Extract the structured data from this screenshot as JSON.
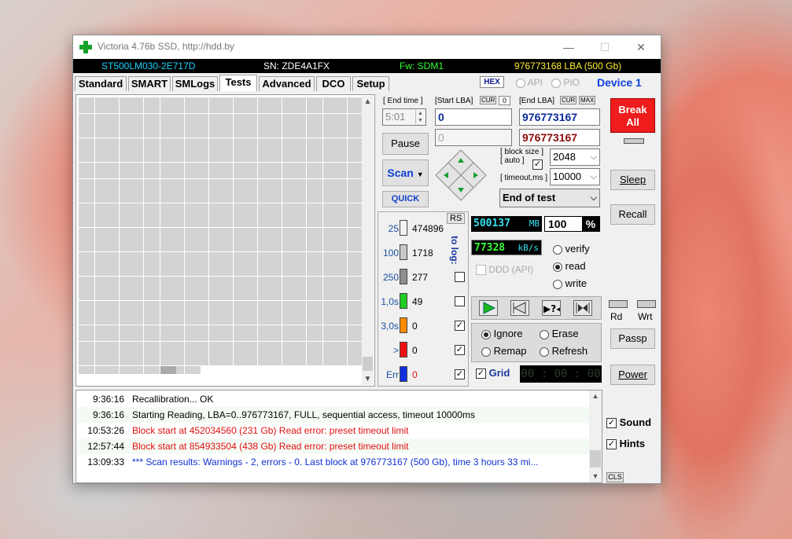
{
  "window": {
    "title": "Victoria 4.76b SSD, http://hdd.by",
    "minimize": "—",
    "maximize": "☐",
    "close": "✕"
  },
  "info": {
    "model": "ST500LM030-2E717D",
    "serial": "SN: ZDE4A1FX",
    "firmware": "Fw: SDM1",
    "capacity": "976773168 LBA (500 Gb)",
    "colors": {
      "model": "#1ad2ff",
      "serial": "#ffffff",
      "firmware": "#33ff33",
      "capacity": "#ffee33"
    }
  },
  "tabs": [
    "Standard",
    "SMART",
    "SMLogs",
    "Tests",
    "Advanced",
    "DCO",
    "Setup"
  ],
  "active_tab": "Tests",
  "mode": {
    "hex": "HEX",
    "api": "API",
    "pio": "PIO",
    "device": "Device 1"
  },
  "test": {
    "end_time_label": "[ End time ]",
    "end_time": "5:01",
    "start_lba_label": "[Start LBA]",
    "start_cur": "CUR",
    "start_zero": "0",
    "start_lba": "0",
    "start_lba2": "0",
    "end_lba_label": "[End LBA]",
    "end_cur": "CUR",
    "end_max": "MAX",
    "end_lba": "976773167",
    "end_lba2": "976773167",
    "pause": "Pause",
    "scan": "Scan",
    "quick": "QUICK",
    "block_size_label": "[ block size ]",
    "auto_label": "[ auto ]",
    "block_size": "2048",
    "timeout_label": "[ timeout,ms ]",
    "timeout": "10000",
    "end_action": "End of test"
  },
  "stats": {
    "rs": "RS",
    "to_log": "to log:",
    "rows": [
      {
        "thr": "25",
        "count": "474896",
        "color": "#f4f4f4",
        "log": null
      },
      {
        "thr": "100",
        "count": "1718",
        "color": "#c8c8c8",
        "log": null
      },
      {
        "thr": "250",
        "count": "277",
        "color": "#8f8f8f",
        "log": false
      },
      {
        "thr": "1,0s",
        "count": "49",
        "color": "#22cc22",
        "log": false
      },
      {
        "thr": "3,0s",
        "count": "0",
        "color": "#ff8a00",
        "log": true
      },
      {
        "thr": ">",
        "count": "0",
        "color": "#ee1111",
        "log": true
      },
      {
        "thr": "Err",
        "count": "0",
        "color": "#1030e0",
        "log": true
      }
    ]
  },
  "progress": {
    "mb": "500137",
    "mb_unit": "MB",
    "percent": "100",
    "percent_unit": "%",
    "speed": "77328",
    "speed_unit": "kB/s",
    "ddd": "DDD (API)",
    "modes": [
      "verify",
      "read",
      "write"
    ],
    "selected_mode": "read",
    "actions": [
      "Ignore",
      "Erase",
      "Remap",
      "Refresh"
    ],
    "selected_action": "Ignore",
    "grid_label": "Grid",
    "timer": "00 : 00 : 00"
  },
  "controls": {
    "break_all": "Break All",
    "sleep": "Sleep",
    "recall": "Recall",
    "rd": "Rd",
    "wrt": "Wrt",
    "passp": "Passp",
    "power": "Power",
    "sound": "Sound",
    "hints": "Hints",
    "cls": "CLS"
  },
  "log": [
    {
      "time": "9:36:16",
      "msg": "Recallibration... OK",
      "color": "#000000",
      "bg": "#ffffff"
    },
    {
      "time": "9:36:16",
      "msg": "Starting Reading, LBA=0..976773167, FULL, sequential access, timeout 10000ms",
      "color": "#000000",
      "bg": "#f4fbf4"
    },
    {
      "time": "10:53:26",
      "msg": "Block start at 452034560 (231 Gb) Read error: preset timeout limit",
      "color": "#e01010",
      "bg": "#ffffff"
    },
    {
      "time": "12:57:44",
      "msg": "Block start at 854933504 (438 Gb) Read error: preset timeout limit",
      "color": "#e01010",
      "bg": "#f4fbf4"
    },
    {
      "time": "13:09:33",
      "msg": "*** Scan results: Warnings - 2, errors - 0. Last block at 976773167 (500 Gb), time 3 hours 33 mi...",
      "color": "#1030d0",
      "bg": "#ffffff"
    }
  ]
}
